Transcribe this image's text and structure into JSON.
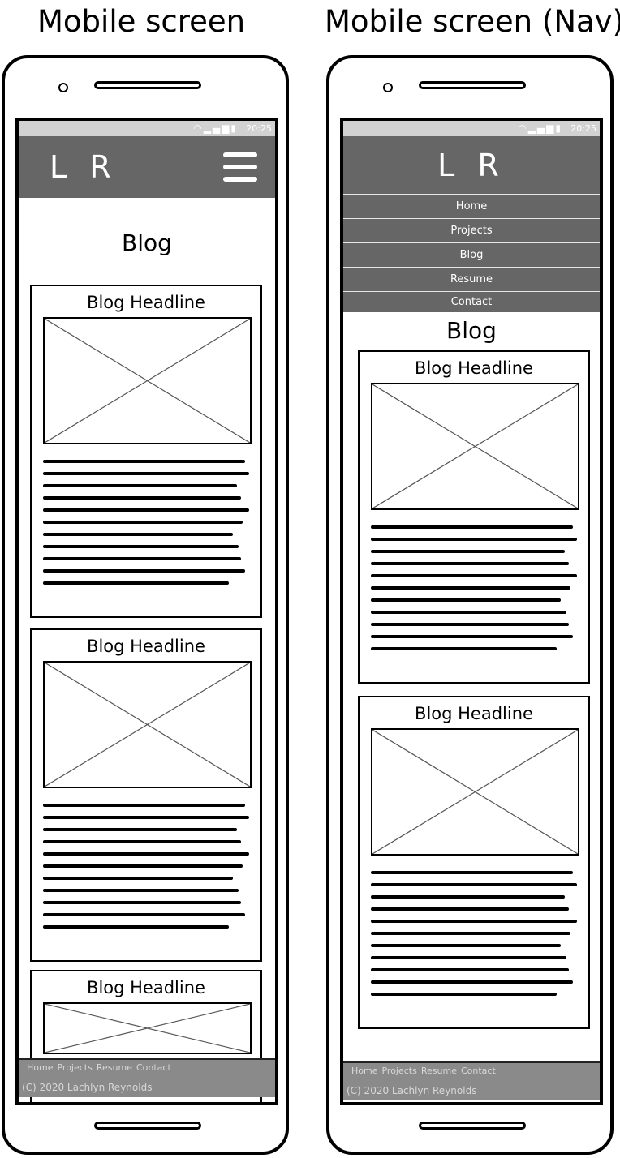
{
  "mockups": [
    {
      "title": "Mobile screen",
      "status_time": "20:25",
      "logo": "L R",
      "page_heading": "Blog",
      "cards": [
        {
          "headline": "Blog Headline"
        },
        {
          "headline": "Blog Headline"
        },
        {
          "headline": "Blog Headline"
        }
      ],
      "footer_links": [
        "Home",
        "Projects",
        "Resume",
        "Contact"
      ],
      "footer_copyright": "(C) 2020 Lachlyn Reynolds"
    },
    {
      "title": "Mobile screen (Nav)",
      "status_time": "20:25",
      "logo": "L R",
      "nav_items": [
        "Home",
        "Projects",
        "Blog",
        "Resume",
        "Contact"
      ],
      "page_heading": "Blog",
      "cards": [
        {
          "headline": "Blog Headline"
        },
        {
          "headline": "Blog Headline"
        }
      ],
      "footer_links": [
        "Home",
        "Projects",
        "Resume",
        "Contact"
      ],
      "footer_copyright": "(C) 2020 Lachlyn Reynolds"
    }
  ],
  "icons": {
    "status": [
      "wifi-icon",
      "signal-icon",
      "battery-icon"
    ],
    "menu": "hamburger-menu-icon",
    "image_placeholder": "image-placeholder-icon"
  },
  "colors": {
    "appbar": "#666666",
    "statusbar": "#d2d2d2",
    "footer": "#8a8a8a"
  }
}
